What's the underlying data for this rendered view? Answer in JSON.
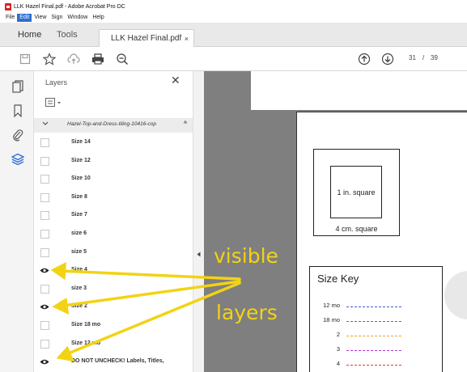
{
  "window": {
    "title": "LLK Hazel Final.pdf - Adobe Acrobat Pro DC"
  },
  "menu": [
    "File",
    "Edit",
    "View",
    "Sign",
    "Window",
    "Help"
  ],
  "menu_active": "Edit",
  "tabs": {
    "home": "Home",
    "tools": "Tools",
    "document": "LLK Hazel Final.pdf",
    "close_glyph": "×"
  },
  "toolbar": {
    "icons": [
      "save-icon",
      "bookmark-star-icon",
      "cloud-upload-icon",
      "print-icon",
      "zoom-out-icon",
      "page-up-icon",
      "page-down-icon"
    ],
    "current_page": "31",
    "separator": "/",
    "total_pages": "39"
  },
  "nav_icons": [
    "pages-icon",
    "bookmarks-icon",
    "attachments-icon",
    "layers-icon"
  ],
  "layers_panel": {
    "title": "Layers",
    "close_glyph": "✕",
    "group_label": "Hazel-Top-and-Dress-tiling-10416-cop",
    "items": [
      {
        "label": "Size 14",
        "visible": false
      },
      {
        "label": "Size 12",
        "visible": false
      },
      {
        "label": "Size 10",
        "visible": false
      },
      {
        "label": "Size 8",
        "visible": false
      },
      {
        "label": "Size 7",
        "visible": false
      },
      {
        "label": "size 6",
        "visible": false
      },
      {
        "label": "size 5",
        "visible": false
      },
      {
        "label": "Size 4",
        "visible": true
      },
      {
        "label": "size 3",
        "visible": false
      },
      {
        "label": "Size 2",
        "visible": true
      },
      {
        "label": "Size 18 mo",
        "visible": false
      },
      {
        "label": "Size 12 mo",
        "visible": false
      },
      {
        "label": "DO NOT UNCHECK! Labels, Titles,",
        "visible": true
      }
    ]
  },
  "document": {
    "inner_square_label": "1 in. square",
    "outer_square_label": "4 cm. square",
    "size_key": {
      "title": "Size Key",
      "rows": [
        {
          "label": "12 mo",
          "color": "#4a55c8"
        },
        {
          "label": "18 mo",
          "color": "#3a8f3a"
        },
        {
          "label": "2",
          "color": "#e8a23a"
        },
        {
          "label": "3",
          "color": "#b03ad0"
        },
        {
          "label": "4",
          "color": "#e23a3a"
        }
      ]
    }
  },
  "annotations": {
    "line1": "visible",
    "line2": "layers",
    "color": "#f2d314"
  }
}
